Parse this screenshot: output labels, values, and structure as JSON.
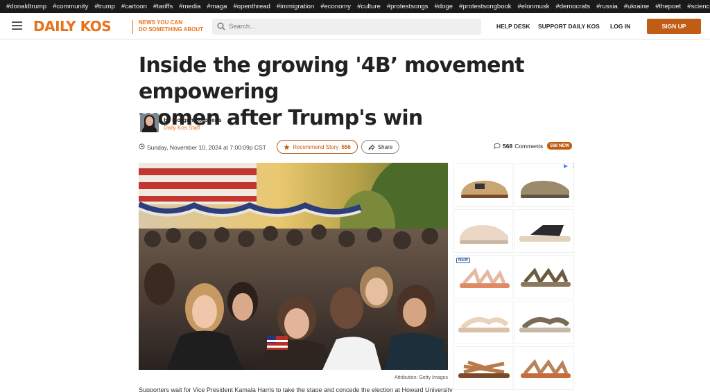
{
  "tags": [
    "#donaldtrump",
    "#community",
    "#trump",
    "#cartoon",
    "#tariffs",
    "#media",
    "#maga",
    "#openthread",
    "#immigration",
    "#economy",
    "#culture",
    "#protestsongs",
    "#doge",
    "#protestsongbook",
    "#elonmusk",
    "#democrats",
    "#russia",
    "#ukraine",
    "#thepoet",
    "#science"
  ],
  "header": {
    "logo": "DAILY KOS",
    "tagline_line1": "NEWS YOU CAN",
    "tagline_line2": "DO SOMETHING ABOUT",
    "search_placeholder": "Search...",
    "nav": {
      "help_desk": "HELP DESK",
      "support": "SUPPORT DAILY KOS",
      "login": "LOG IN",
      "signup": "SIGN UP"
    }
  },
  "article": {
    "headline_line1": "Inside the growing '4B’ movement empowering",
    "headline_line2": "women after Trump's win",
    "author": "by Morgan Stephens",
    "author_role": "Daily Kos Staff",
    "date": "Sunday, November 10, 2024 at 7:00:09p CST",
    "recommend_label": "Recommend Story",
    "recommend_count": "556",
    "share_label": "Share",
    "comment_count": "568",
    "comment_label": "Comments",
    "new_badge": "568 NEW",
    "attribution": "Attribution: Getty Images",
    "caption": "Supporters wait for Vice President Kamala Harris to take the stage and concede the election at Howard University"
  },
  "ad": {
    "new_label": "NEW"
  },
  "colors": {
    "brand_orange": "#e8731d",
    "button_orange": "#c05c14",
    "tag_bar": "#1a1a1a"
  }
}
